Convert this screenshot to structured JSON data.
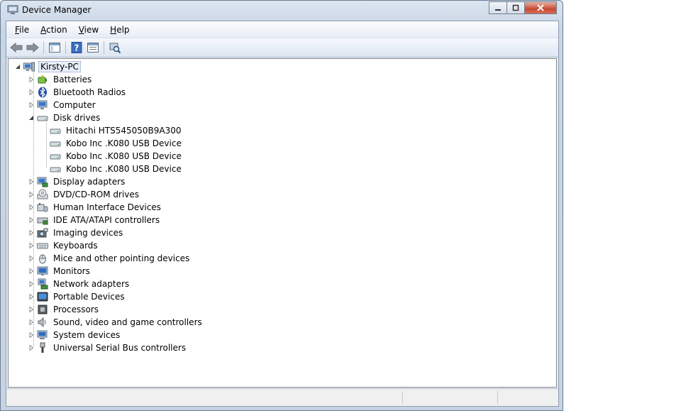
{
  "window": {
    "title": "Device Manager"
  },
  "menu": {
    "file": "File",
    "action": "Action",
    "view": "View",
    "help": "Help"
  },
  "toolbar": {
    "buttons": [
      "back-icon",
      "forward-icon",
      "console-tree-icon",
      "help-icon",
      "properties-icon",
      "scan-hardware-icon"
    ]
  },
  "tree": {
    "root": "Kirsty-PC",
    "categories": [
      {
        "label": "Batteries",
        "icon": "battery-icon"
      },
      {
        "label": "Bluetooth Radios",
        "icon": "bluetooth-icon"
      },
      {
        "label": "Computer",
        "icon": "computer-icon"
      },
      {
        "label": "Disk drives",
        "icon": "disk-drive-icon"
      },
      {
        "label": "Display adapters",
        "icon": "display-adapter-icon"
      },
      {
        "label": "DVD/CD-ROM drives",
        "icon": "dvd-drive-icon"
      },
      {
        "label": "Human Interface Devices",
        "icon": "hid-icon"
      },
      {
        "label": "IDE ATA/ATAPI controllers",
        "icon": "ide-controller-icon"
      },
      {
        "label": "Imaging devices",
        "icon": "camera-icon"
      },
      {
        "label": "Keyboards",
        "icon": "keyboard-icon"
      },
      {
        "label": "Mice and other pointing devices",
        "icon": "mouse-icon"
      },
      {
        "label": "Monitors",
        "icon": "monitor-icon"
      },
      {
        "label": "Network adapters",
        "icon": "network-adapter-icon"
      },
      {
        "label": "Portable Devices",
        "icon": "portable-device-icon"
      },
      {
        "label": "Processors",
        "icon": "processor-icon"
      },
      {
        "label": "Sound, video and game controllers",
        "icon": "speaker-icon"
      },
      {
        "label": "System devices",
        "icon": "system-device-icon"
      },
      {
        "label": "Universal Serial Bus controllers",
        "icon": "usb-icon"
      }
    ],
    "disk_drives": [
      "Hitachi HTS545050B9A300",
      "Kobo Inc .K080 USB Device",
      "Kobo Inc .K080 USB Device",
      "Kobo Inc .K080 USB Device"
    ]
  },
  "colors": {
    "selection": "#e8eff9",
    "titlebar": "#c9d6e6",
    "close_button": "#c74a33"
  }
}
